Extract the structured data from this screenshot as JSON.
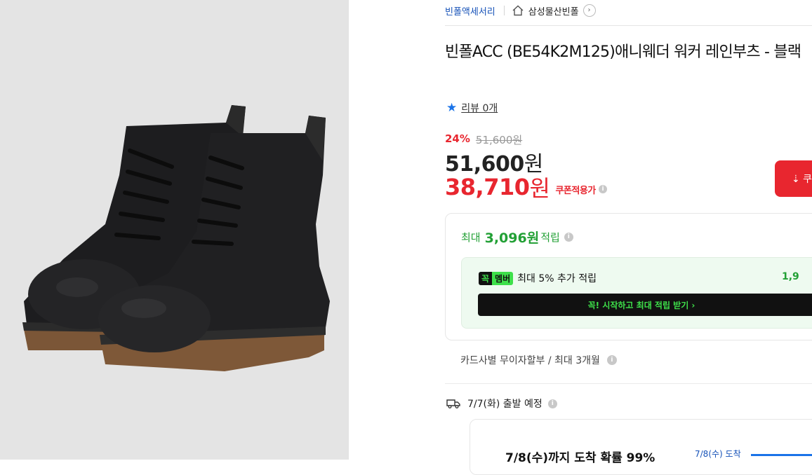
{
  "breadcrumb": {
    "brand": "빈폴액세서리",
    "store": "삼성물산빈폴",
    "chevron": "›"
  },
  "product": {
    "title": "빈폴ACC (BE54K2M125)애니웨더 워커 레인부츠 - 블랙",
    "review_link": "리뷰 0개",
    "star_icon": "star-icon"
  },
  "price": {
    "discount_rate": "24%",
    "original": "51,600원",
    "sale_amount": "51,600",
    "coupon_amount": "38,710",
    "won": "원",
    "coupon_label": "쿠폰적용가",
    "coupon_button_icon": "⇣ 쿠"
  },
  "reward": {
    "prefix": "최대",
    "amount": "3,096원",
    "suffix": "적립",
    "badge_k": "꼭",
    "badge_m": "멤버",
    "member_text": "최대 5% 추가 적립",
    "member_amount": "1,9",
    "cta": "꼭! 시작하고 최대 적립 받기  ›"
  },
  "installment": "카드사별 무이자할부 / 최대 3개월",
  "shipping": {
    "departure": "7/7(화) 출발 예정",
    "arrival_head": "7/8(수)까지 도착 확률 99%",
    "arrival_date": "7/8(수) 도착"
  },
  "colors": {
    "accent_red": "#e8262f",
    "link_blue": "#1652b8",
    "reward_green": "#22a035",
    "member_green": "#3ee04a"
  }
}
